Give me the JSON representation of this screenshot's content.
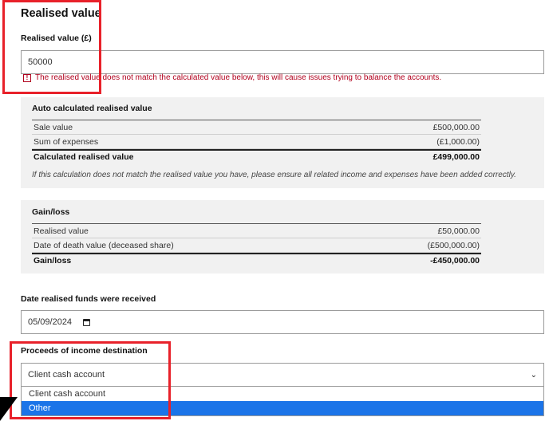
{
  "section_title": "Realised value",
  "realised_value": {
    "label": "Realised value (£)",
    "value": "50000",
    "error_icon": "!",
    "error_message": "The realised value does not match the calculated value below, this will cause issues trying to balance the accounts."
  },
  "auto_calc": {
    "title": "Auto calculated realised value",
    "rows": [
      {
        "label": "Sale value",
        "value": "£500,000.00"
      },
      {
        "label": "Sum of expenses",
        "value": "(£1,000.00)"
      }
    ],
    "total": {
      "label": "Calculated realised value",
      "value": "£499,000.00"
    },
    "note": "If this calculation does not match the realised value you have, please ensure all related income and expenses have been added correctly."
  },
  "gain_loss": {
    "title": "Gain/loss",
    "rows": [
      {
        "label": "Realised value",
        "value": "£50,000.00"
      },
      {
        "label": "Date of death value (deceased share)",
        "value": "(£500,000.00)"
      }
    ],
    "total": {
      "label": "Gain/loss",
      "value": "-£450,000.00"
    }
  },
  "date_received": {
    "label": "Date realised funds were received",
    "value": "05/09/2024"
  },
  "proceeds_destination": {
    "label": "Proceeds of income destination",
    "selected": "Client cash account",
    "options": [
      "Client cash account",
      "Other"
    ],
    "highlighted_option": "Other"
  },
  "colors": {
    "error": "#b1001d",
    "highlight_border": "#e8212a",
    "option_selected": "#1b74e8",
    "panel_bg": "#f1f1f1"
  }
}
